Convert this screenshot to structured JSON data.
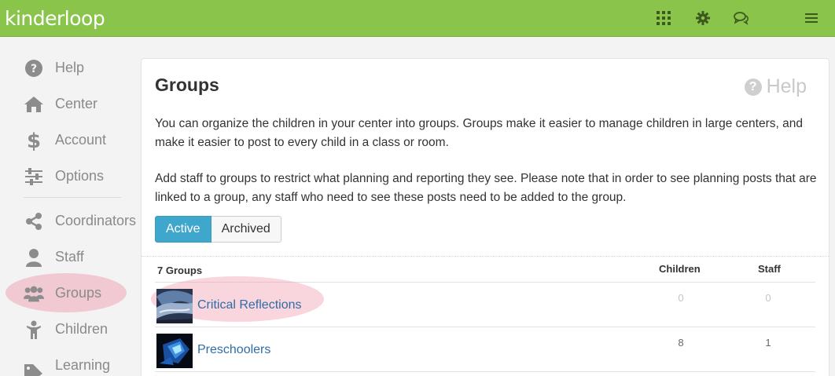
{
  "app": {
    "logo": "kinderloop"
  },
  "topbar": {
    "icons": [
      "apps-grid-icon",
      "gear-icon",
      "chat-icon",
      "hamburger-menu-icon"
    ],
    "color": "#8ac44a"
  },
  "sidebar": {
    "items": [
      {
        "label": "Help",
        "icon": "question-circle-icon"
      },
      {
        "label": "Center",
        "icon": "home-icon"
      },
      {
        "label": "Account",
        "icon": "dollar-icon"
      },
      {
        "label": "Options",
        "icon": "sliders-icon"
      },
      {
        "label": "Coordinators",
        "icon": "share-icon"
      },
      {
        "label": "Staff",
        "icon": "user-icon"
      },
      {
        "label": "Groups",
        "icon": "users-icon"
      },
      {
        "label": "Children",
        "icon": "child-icon"
      },
      {
        "label": "Learning",
        "icon": "tag-icon"
      }
    ]
  },
  "main": {
    "title": "Groups",
    "help_label": "Help",
    "para1": "You can organize the children in your center into groups. Groups make it easier to manage children in large centers, and make it easier to post to every child in a class or room.",
    "para2": "Add staff to groups to restrict what planning and reporting they see. Please note that in order to see planning posts that are linked to a group, any staff who need to see these posts need to be added to the group.",
    "tabs": {
      "active": "Active",
      "archived": "Archived"
    },
    "accent": "#3fa6cc",
    "table": {
      "headers": {
        "count": "7 Groups",
        "children": "Children",
        "staff": "Staff"
      },
      "rows": [
        {
          "name": "Critical Reflections",
          "children": "0",
          "staff": "0",
          "muted": true
        },
        {
          "name": "Preschoolers",
          "children": "8",
          "staff": "1",
          "muted": false
        }
      ]
    }
  }
}
